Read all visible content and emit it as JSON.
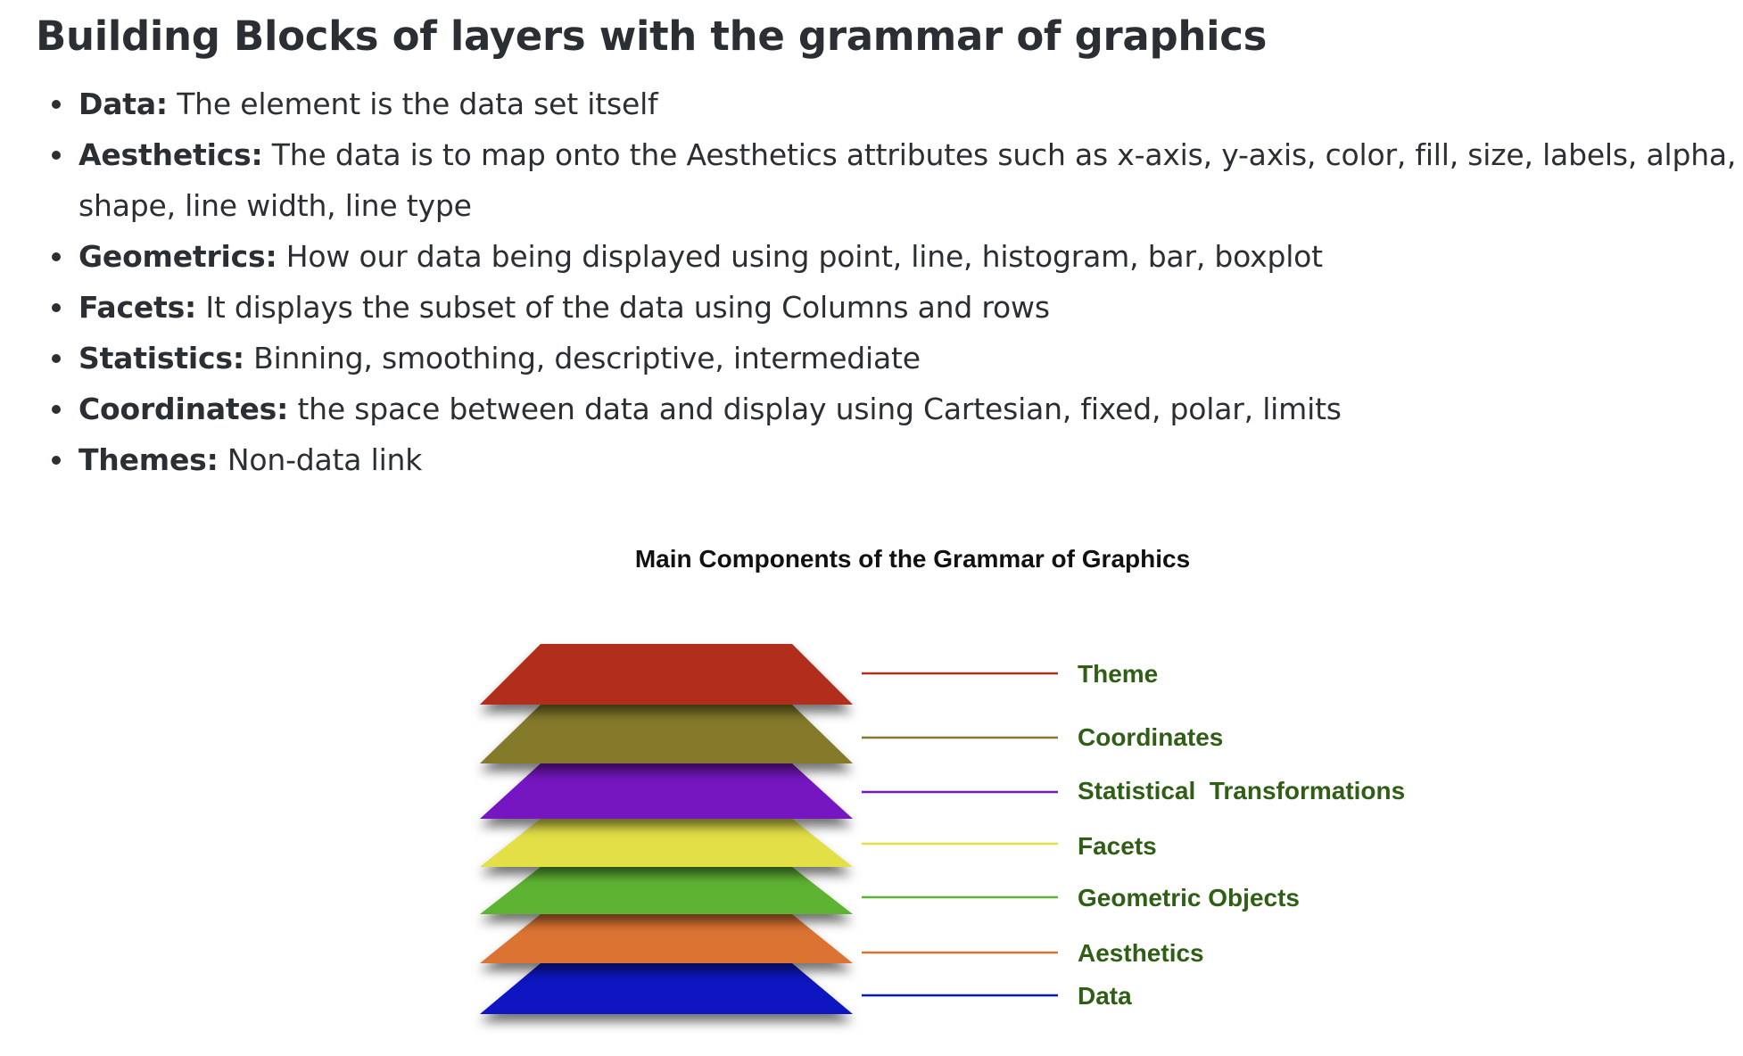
{
  "page_title": "Building Blocks of layers with the grammar of graphics",
  "bullets": [
    {
      "term": "Data:",
      "text": "The element is the data set itself"
    },
    {
      "term": "Aesthetics:",
      "text": "The data is to map onto the Aesthetics attributes such as x-axis, y-axis, color, fill, size, labels, alpha, shape, line width, line type"
    },
    {
      "term": "Geometrics:",
      "text": "How our data being displayed using point, line, histogram, bar, boxplot"
    },
    {
      "term": "Facets:",
      "text": "It displays the subset of the data using Columns and rows"
    },
    {
      "term": "Statistics:",
      "text": "Binning, smoothing, descriptive, intermediate"
    },
    {
      "term": "Coordinates:",
      "text": "the space between data and display using Cartesian, fixed, polar, limits"
    },
    {
      "term": "Themes:",
      "text": "Non-data link"
    }
  ],
  "diagram": {
    "title": "Main Components of the Grammar of Graphics",
    "layers": [
      {
        "label": "Theme",
        "color": "#b22e1c"
      },
      {
        "label": "Coordinates",
        "color": "#857a2c"
      },
      {
        "label": "Statistical  Transformations",
        "color": "#7517c0"
      },
      {
        "label": "Facets",
        "color": "#e2df47"
      },
      {
        "label": "Geometric Objects",
        "color": "#5db332"
      },
      {
        "label": "Aesthetics",
        "color": "#db7330"
      },
      {
        "label": "Data",
        "color": "#0918c0"
      }
    ]
  }
}
